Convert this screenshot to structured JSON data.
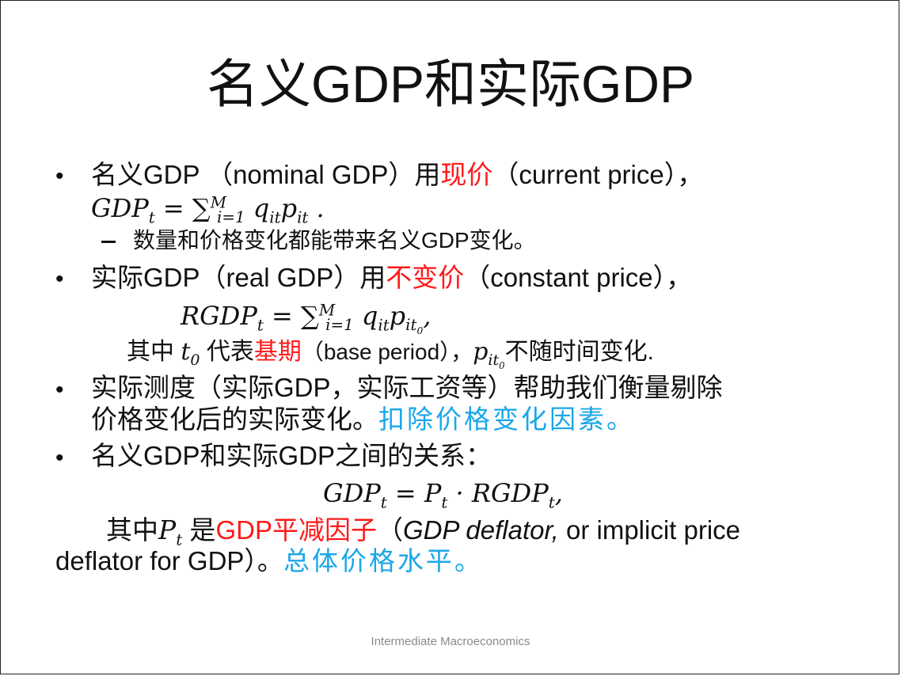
{
  "slide": {
    "title": "名义GDP和实际GDP",
    "footer": "Intermediate Macroeconomics",
    "bullet_glyph": "•",
    "b1": {
      "lead": "名义GDP （nominal GDP）用",
      "highlight": "现价",
      "tail": "（current price），",
      "formula_lhs": "GDP",
      "formula_lhs_sub": "t",
      "formula_rhs": "= ∑",
      "formula_sum_sub": "i=1",
      "formula_sum_sup": "M",
      "formula_q": "q",
      "formula_q_sub": "it",
      "formula_p": "p",
      "formula_p_sub": "it",
      "formula_end": " .",
      "sub": "数量和价格变化都能带来名义GDP变化。"
    },
    "b2": {
      "lead": "实际GDP（real GDP）用",
      "highlight": "不变价",
      "tail": "（constant price），",
      "formula_lhs": "RGDP",
      "formula_lhs_sub": "t",
      "formula_rhs": "= ∑",
      "formula_sum_sub": "i=1",
      "formula_sum_sup": "M",
      "formula_q": "q",
      "formula_q_sub": "it",
      "formula_p": "p",
      "formula_p_sub": "it",
      "formula_p_subsub": "0",
      "formula_end": ",",
      "note_lead": "其中 ",
      "note_t": "t",
      "note_t_sub": "0",
      "note_mid": " 代表",
      "note_highlight": "基期",
      "note_tail": "（base period），",
      "note_p": "p",
      "note_p_sub": "it",
      "note_p_subsub": "0",
      "note_end": "不随时间变化."
    },
    "b3": {
      "line1": "实际测度（实际GDP，实际工资等）帮助我们衡量剔除",
      "line2": "价格变化后的实际变化。",
      "highlight": "扣除价格变化因素。"
    },
    "b4": {
      "lead": "名义GDP和实际GDP之间的关系：",
      "eq_gdp": "GDP",
      "eq_gdp_sub": "t",
      "eq_mid": " = P",
      "eq_p_sub": "t",
      "eq_dot": " · RGDP",
      "eq_r_sub": "t",
      "eq_end": ",",
      "note_lead": "其中",
      "note_p": "P",
      "note_p_sub": "t",
      "note_mid": " 是",
      "note_highlight": "GDP平减因子",
      "note_open": "（",
      "note_italic": "GDP deflator,",
      "note_tail": " or implicit price",
      "line2": "deflator for GDP）。",
      "line2_highlight": "总体价格水平。"
    }
  }
}
